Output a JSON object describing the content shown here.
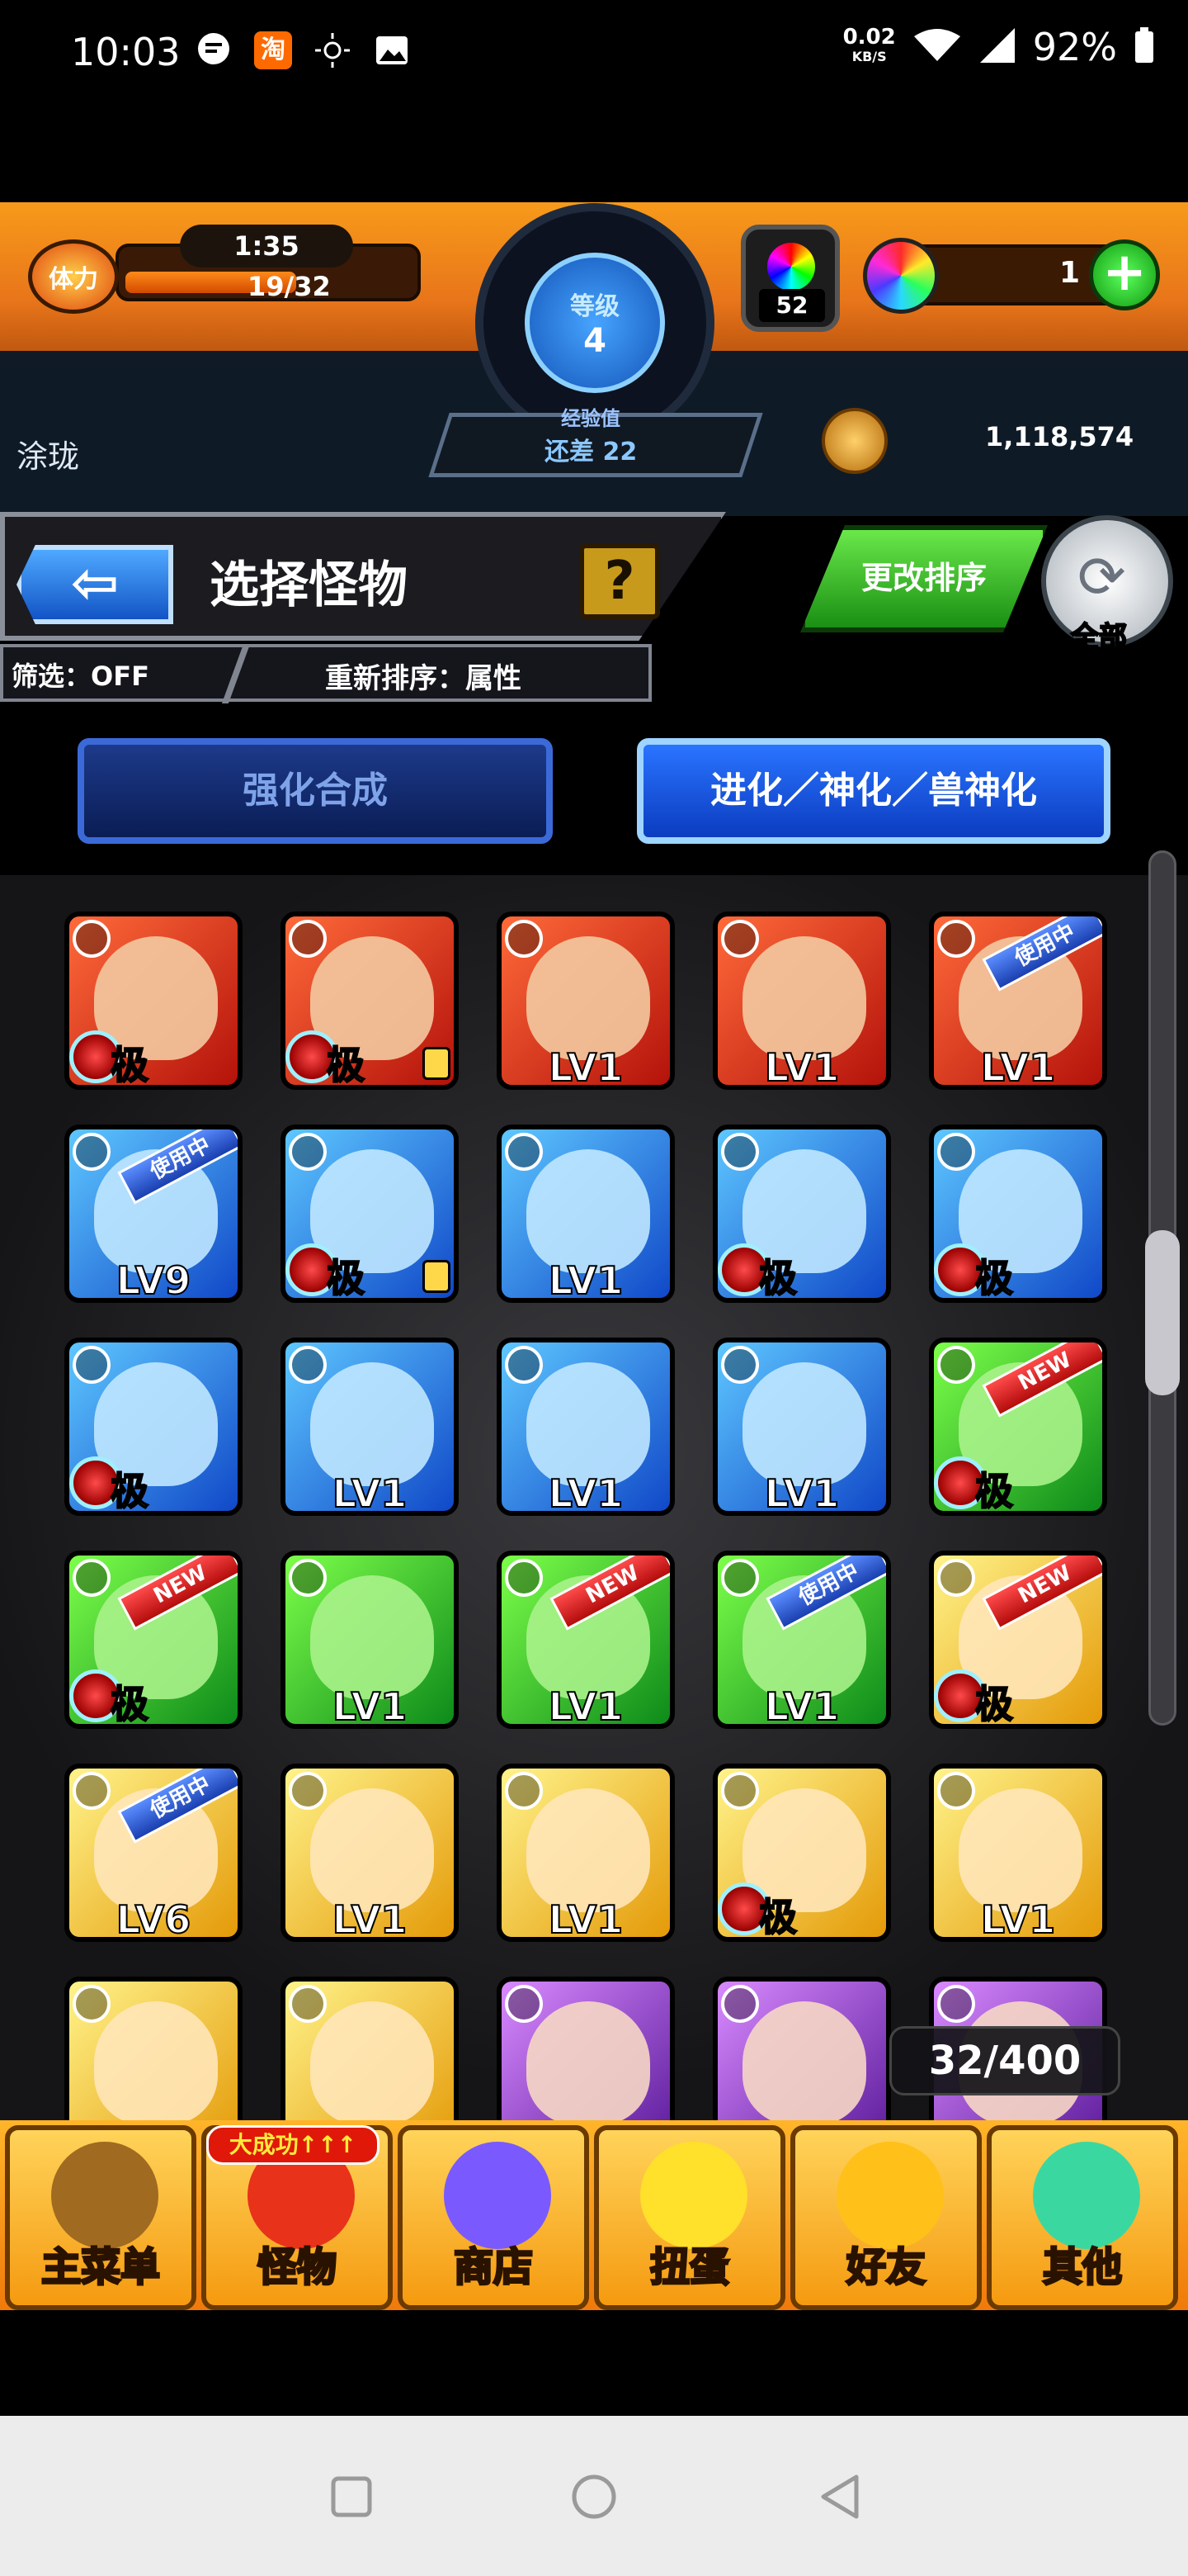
{
  "status_bar": {
    "time": "10:03",
    "net_speed": "0.02",
    "net_unit": "KB/S",
    "battery": "92%",
    "icons": [
      "chat-icon",
      "taobao-icon",
      "brightness-icon",
      "image-icon",
      "wifi-icon",
      "signal-icon",
      "battery-icon"
    ],
    "taobao_label": "淘"
  },
  "header": {
    "stamina_label": "体力",
    "stamina_timer": "1:35",
    "stamina_value": "19/32",
    "stamina_fraction": 0.59,
    "level_label": "等级",
    "level": "4",
    "exp_label": "经验值",
    "exp_remaining": "还差 22",
    "potion_count": "52",
    "orb_count": "1",
    "plus_label": "+",
    "user_name": "涂珑",
    "gold": "1,118,574"
  },
  "title_bar": {
    "back_label": "⇦",
    "title": "选择怪物",
    "help_label": "?",
    "filter": "筛选：OFF",
    "sort": "重新排序：属性",
    "change_sort": "更改排序",
    "all_label": "全部"
  },
  "tabs": [
    {
      "label": "强化合成",
      "active": false
    },
    {
      "label": "进化／神化／兽神化",
      "active": true
    }
  ],
  "monsters": [
    {
      "element": "fire",
      "level": "",
      "extreme": "极",
      "fruit": true,
      "locked": false,
      "tag": ""
    },
    {
      "element": "fire",
      "level": "",
      "extreme": "极",
      "fruit": true,
      "locked": true,
      "tag": ""
    },
    {
      "element": "fire",
      "level": "LV1",
      "extreme": "",
      "fruit": false,
      "locked": false,
      "tag": ""
    },
    {
      "element": "fire",
      "level": "LV1",
      "extreme": "",
      "fruit": false,
      "locked": false,
      "tag": ""
    },
    {
      "element": "fire",
      "level": "LV1",
      "extreme": "",
      "fruit": false,
      "locked": false,
      "tag": "使用中"
    },
    {
      "element": "water",
      "level": "LV9",
      "extreme": "",
      "fruit": false,
      "locked": false,
      "tag": "使用中"
    },
    {
      "element": "water",
      "level": "",
      "extreme": "极",
      "fruit": true,
      "locked": true,
      "tag": ""
    },
    {
      "element": "water",
      "level": "LV1",
      "extreme": "",
      "fruit": false,
      "locked": false,
      "tag": ""
    },
    {
      "element": "water",
      "level": "",
      "extreme": "极",
      "fruit": true,
      "locked": false,
      "tag": ""
    },
    {
      "element": "water",
      "level": "",
      "extreme": "极",
      "fruit": true,
      "locked": false,
      "tag": ""
    },
    {
      "element": "water",
      "level": "",
      "extreme": "极",
      "fruit": true,
      "locked": false,
      "tag": ""
    },
    {
      "element": "water",
      "level": "LV1",
      "extreme": "",
      "fruit": false,
      "locked": false,
      "tag": ""
    },
    {
      "element": "water",
      "level": "LV1",
      "extreme": "",
      "fruit": false,
      "locked": false,
      "tag": ""
    },
    {
      "element": "water",
      "level": "LV1",
      "extreme": "",
      "fruit": false,
      "locked": false,
      "tag": ""
    },
    {
      "element": "wood",
      "level": "",
      "extreme": "极",
      "fruit": true,
      "locked": false,
      "tag": "NEW"
    },
    {
      "element": "wood",
      "level": "",
      "extreme": "极",
      "fruit": true,
      "locked": false,
      "tag": "NEW"
    },
    {
      "element": "wood",
      "level": "LV1",
      "extreme": "",
      "fruit": false,
      "locked": false,
      "tag": ""
    },
    {
      "element": "wood",
      "level": "LV1",
      "extreme": "",
      "fruit": false,
      "locked": false,
      "tag": "NEW"
    },
    {
      "element": "wood",
      "level": "LV1",
      "extreme": "",
      "fruit": false,
      "locked": false,
      "tag": "使用中"
    },
    {
      "element": "light",
      "level": "",
      "extreme": "极",
      "fruit": true,
      "locked": false,
      "tag": "NEW"
    },
    {
      "element": "light",
      "level": "LV6",
      "extreme": "",
      "fruit": false,
      "locked": false,
      "tag": "使用中"
    },
    {
      "element": "light",
      "level": "LV1",
      "extreme": "",
      "fruit": false,
      "locked": false,
      "tag": ""
    },
    {
      "element": "light",
      "level": "LV1",
      "extreme": "",
      "fruit": false,
      "locked": false,
      "tag": ""
    },
    {
      "element": "light",
      "level": "",
      "extreme": "极",
      "fruit": true,
      "locked": false,
      "tag": ""
    },
    {
      "element": "light",
      "level": "LV1",
      "extreme": "",
      "fruit": false,
      "locked": false,
      "tag": ""
    },
    {
      "element": "light",
      "level": "",
      "extreme": "",
      "fruit": false,
      "locked": false,
      "tag": ""
    },
    {
      "element": "light",
      "level": "",
      "extreme": "",
      "fruit": false,
      "locked": false,
      "tag": ""
    },
    {
      "element": "dark",
      "level": "",
      "extreme": "",
      "fruit": false,
      "locked": false,
      "tag": ""
    },
    {
      "element": "dark",
      "level": "",
      "extreme": "",
      "fruit": false,
      "locked": false,
      "tag": ""
    },
    {
      "element": "dark",
      "level": "",
      "extreme": "",
      "fruit": false,
      "locked": false,
      "tag": ""
    }
  ],
  "box_count": "32/400",
  "nav": {
    "badge": "大成功↑↑↑",
    "items": [
      {
        "label": "主菜单",
        "icon": "gate-icon",
        "color": "#a06a20"
      },
      {
        "label": "怪物",
        "icon": "dragon-icon",
        "color": "#e8321a"
      },
      {
        "label": "商店",
        "icon": "orb-icon",
        "color": "#7a5aff"
      },
      {
        "label": "扭蛋",
        "icon": "egg-icon",
        "color": "#ffe02a"
      },
      {
        "label": "好友",
        "icon": "friends-icon",
        "color": "#ffc01a"
      },
      {
        "label": "其他",
        "icon": "other-icon",
        "color": "#3ad8a0"
      }
    ]
  },
  "system_nav": [
    "recent-apps-icon",
    "home-icon",
    "back-icon"
  ]
}
